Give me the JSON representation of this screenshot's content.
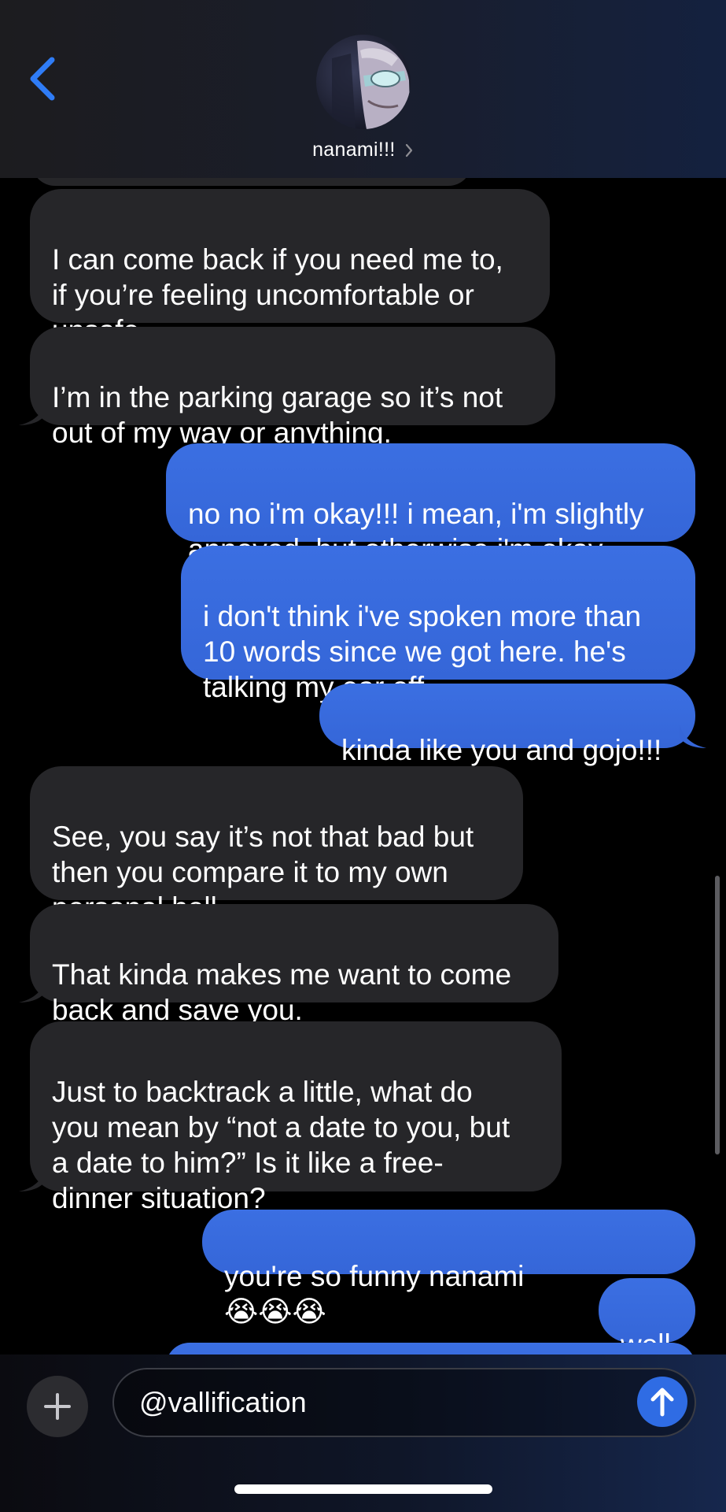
{
  "header": {
    "contact_name": "nanami!!!",
    "back_icon": "chevron-left-icon",
    "name_chevron_icon": "chevron-right-icon"
  },
  "messages": [
    {
      "direction": "received",
      "text": "I can come back if you need me to,\nif you’re feeling uncomfortable or\nunsafe."
    },
    {
      "direction": "received",
      "text": "I’m in the parking garage so it’s not\nout of my way or anything."
    },
    {
      "direction": "sent",
      "text": "no no i'm okay!!! i mean, i'm slightly\nannoyed, but otherwise i'm okay",
      "emoji": "👍"
    },
    {
      "direction": "sent",
      "text": "i don't think i've spoken more than\n10 words since we got here. he's\ntalking my ear off"
    },
    {
      "direction": "sent",
      "text": "kinda like you and gojo!!!"
    },
    {
      "direction": "received",
      "text": "See, you say it’s not that bad but\nthen you compare it to my own\npersonal hell"
    },
    {
      "direction": "received",
      "text": "That kinda makes me want to come\nback and save you."
    },
    {
      "direction": "received",
      "text": "Just to backtrack a little, what do\nyou mean by “not a date to you, but\na date to him?” Is it like a free-\ndinner situation?"
    },
    {
      "direction": "sent",
      "text": "you're so funny nanami",
      "emoji": "😭😭😭"
    },
    {
      "direction": "sent",
      "text": "well"
    }
  ],
  "compose": {
    "input_value": "@vallification",
    "plus_icon": "plus-icon",
    "send_icon": "arrow-up-icon"
  },
  "colors": {
    "sent_bubble": "#3a6de0",
    "received_bubble": "#262629",
    "accent_blue": "#2f7cf6"
  }
}
